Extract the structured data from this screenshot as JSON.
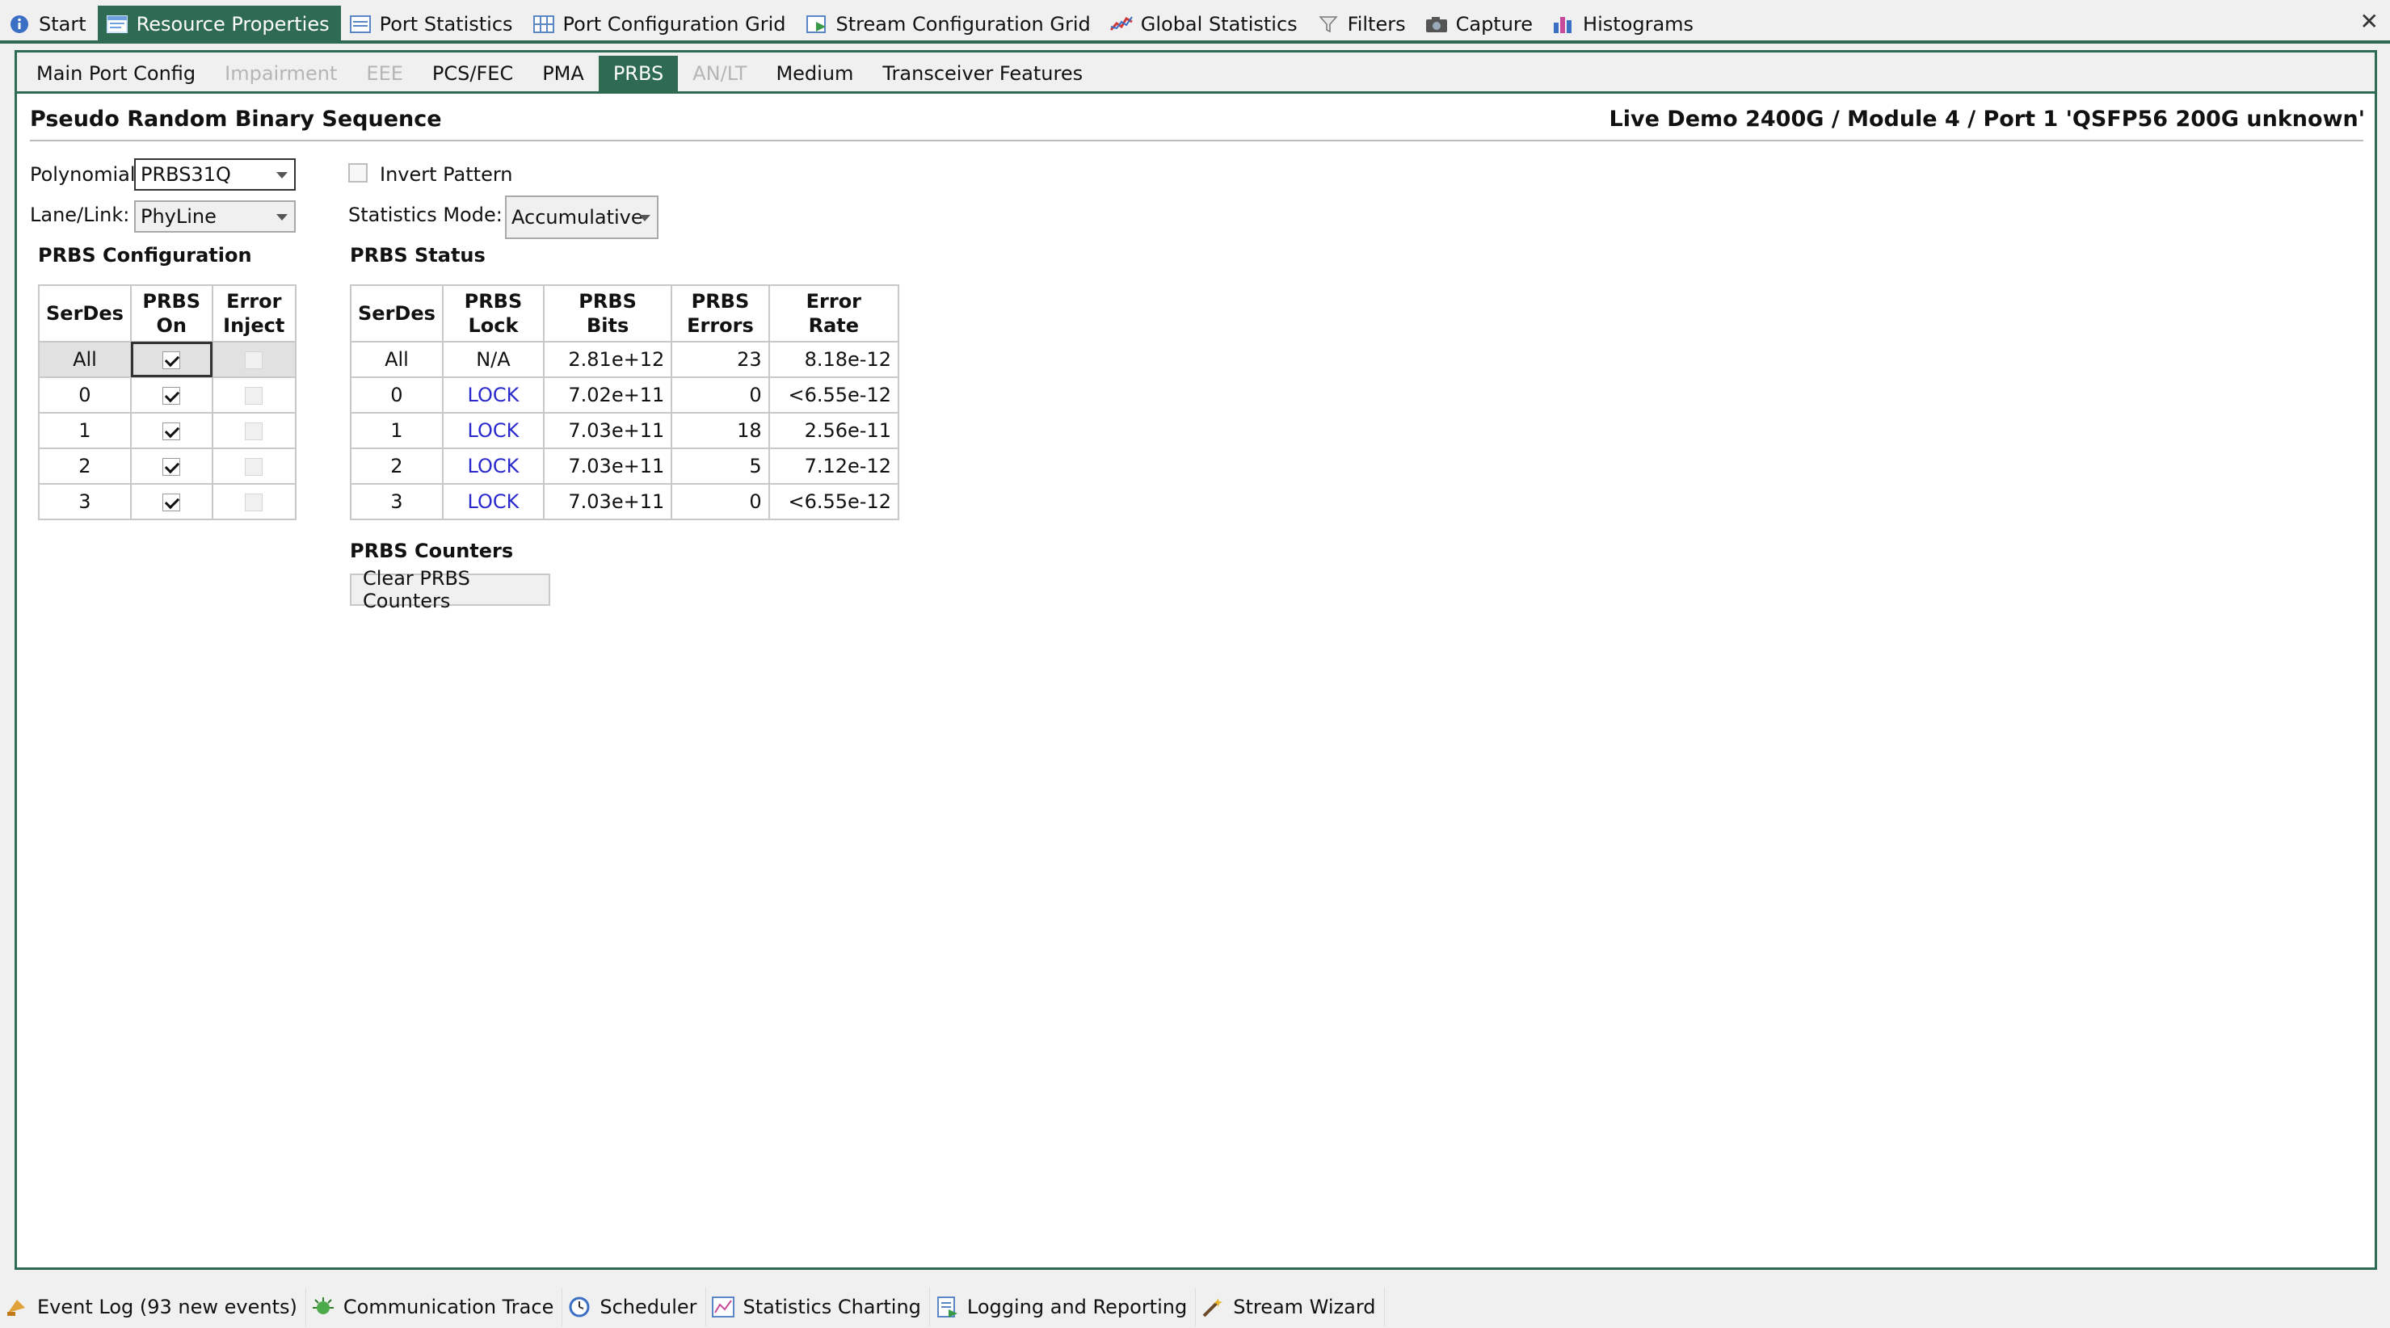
{
  "top_tabs": [
    {
      "label": "Start",
      "icon": "info-icon"
    },
    {
      "label": "Resource Properties",
      "icon": "properties-icon",
      "active": true
    },
    {
      "label": "Port Statistics",
      "icon": "statistics-table-icon"
    },
    {
      "label": "Port Configuration Grid",
      "icon": "grid-icon"
    },
    {
      "label": "Stream Configuration Grid",
      "icon": "stream-grid-icon"
    },
    {
      "label": "Global Statistics",
      "icon": "line-chart-icon"
    },
    {
      "label": "Filters",
      "icon": "filter-icon"
    },
    {
      "label": "Capture",
      "icon": "camera-icon"
    },
    {
      "label": "Histograms",
      "icon": "bar-chart-icon"
    }
  ],
  "close_label": "✕",
  "sub_tabs": [
    {
      "label": "Main Port Config",
      "state": "normal"
    },
    {
      "label": "Impairment",
      "state": "disabled"
    },
    {
      "label": "EEE",
      "state": "disabled"
    },
    {
      "label": "PCS/FEC",
      "state": "normal"
    },
    {
      "label": "PMA",
      "state": "normal"
    },
    {
      "label": "PRBS",
      "state": "active"
    },
    {
      "label": "AN/LT",
      "state": "disabled"
    },
    {
      "label": "Medium",
      "state": "normal"
    },
    {
      "label": "Transceiver Features",
      "state": "normal"
    }
  ],
  "page": {
    "title": "Pseudo Random Binary Sequence",
    "port_title": "Live Demo 2400G / Module 4 / Port 1 'QSFP56 200G unknown'"
  },
  "settings": {
    "polynomial_label": "Polynomial:",
    "polynomial_value": "PRBS31Q",
    "lane_label": "Lane/Link:",
    "lane_value": "PhyLine",
    "invert_label": "Invert Pattern",
    "invert_checked": false,
    "stats_mode_label": "Statistics Mode:",
    "stats_mode_value": "Accumulative"
  },
  "config": {
    "heading": "PRBS Configuration",
    "col_serdes": "SerDes",
    "col_on_1": "PRBS",
    "col_on_2": "On",
    "col_err_1": "Error",
    "col_err_2": "Inject",
    "rows": [
      {
        "serdes": "All",
        "on": true,
        "inject": false
      },
      {
        "serdes": "0",
        "on": true,
        "inject": false
      },
      {
        "serdes": "1",
        "on": true,
        "inject": false
      },
      {
        "serdes": "2",
        "on": true,
        "inject": false
      },
      {
        "serdes": "3",
        "on": true,
        "inject": false
      }
    ]
  },
  "status": {
    "heading": "PRBS Status",
    "col_serdes": "SerDes",
    "col_lock_1": "PRBS",
    "col_lock_2": "Lock",
    "col_bits_1": "PRBS",
    "col_bits_2": "Bits",
    "col_errors_1": "PRBS",
    "col_errors_2": "Errors",
    "col_rate_1": "Error",
    "col_rate_2": "Rate",
    "lock_color": "#2a2acc",
    "rows": [
      {
        "serdes": "All",
        "lock": "N/A",
        "bits": "2.81e+12",
        "errors": "23",
        "rate": "8.18e-12"
      },
      {
        "serdes": "0",
        "lock": "LOCK",
        "bits": "7.02e+11",
        "errors": "0",
        "rate": "<6.55e-12"
      },
      {
        "serdes": "1",
        "lock": "LOCK",
        "bits": "7.03e+11",
        "errors": "18",
        "rate": "2.56e-11"
      },
      {
        "serdes": "2",
        "lock": "LOCK",
        "bits": "7.03e+11",
        "errors": "5",
        "rate": "7.12e-12"
      },
      {
        "serdes": "3",
        "lock": "LOCK",
        "bits": "7.03e+11",
        "errors": "0",
        "rate": "<6.55e-12"
      }
    ]
  },
  "counters": {
    "heading": "PRBS Counters",
    "clear_button": "Clear PRBS Counters"
  },
  "bottom_tabs": [
    {
      "label": "Event Log (93 new events)",
      "icon": "event-log-icon"
    },
    {
      "label": "Communication Trace",
      "icon": "communication-trace-icon"
    },
    {
      "label": "Scheduler",
      "icon": "scheduler-icon"
    },
    {
      "label": "Statistics Charting",
      "icon": "statistics-chart-icon"
    },
    {
      "label": "Logging and Reporting",
      "icon": "logging-icon"
    },
    {
      "label": "Stream Wizard",
      "icon": "wizard-icon"
    }
  ],
  "colors": {
    "accent": "#2f6b52",
    "lock_link": "#2a2acc"
  }
}
